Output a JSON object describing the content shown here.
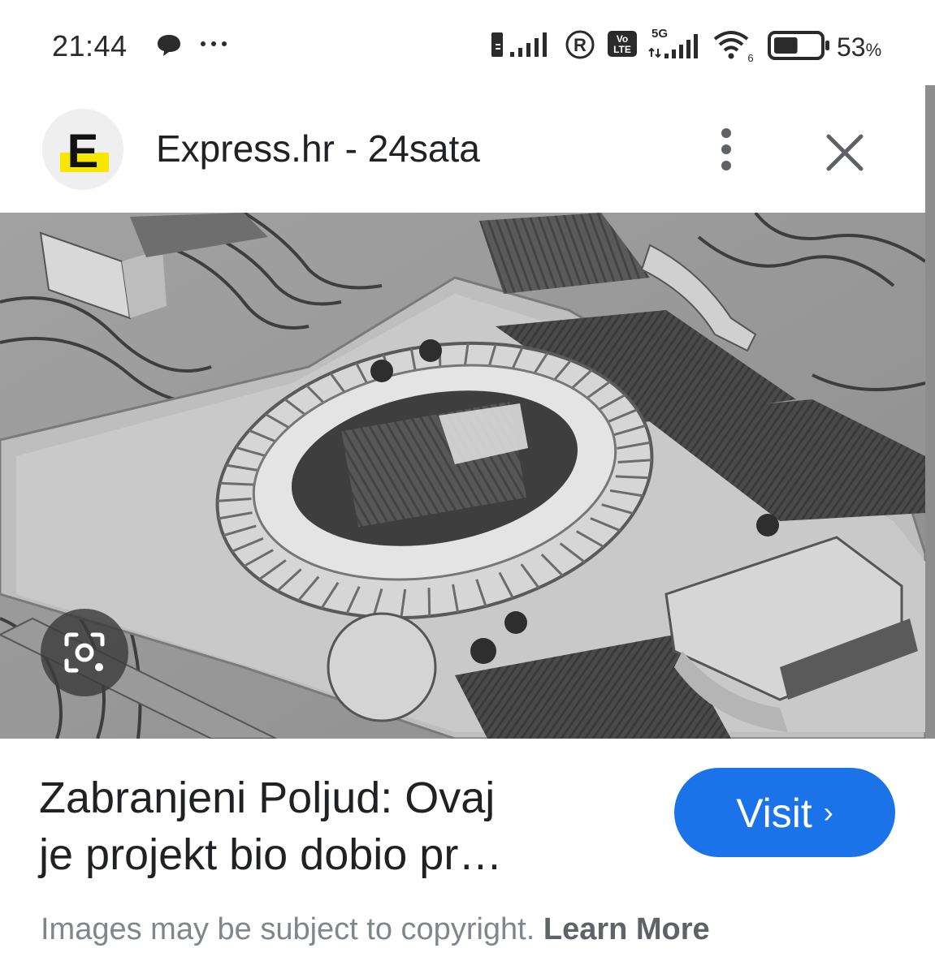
{
  "status_bar": {
    "time": "21:44",
    "left_icons": [
      "chat-bubble-icon",
      "more-dots-icon"
    ],
    "right_icons": [
      "sim-icon",
      "signal-bars-icon",
      "roaming-icon",
      "volte-icon",
      "5g-signal-icon",
      "wifi-6-icon",
      "battery-icon"
    ],
    "network_label": "5G",
    "volte_label": "Vo LTE",
    "wifi_label": "6",
    "roaming_label": "R",
    "battery_percent": "53",
    "battery_percent_symbol": "%",
    "battery_level": 0.53
  },
  "header": {
    "source_logo_letter": "E",
    "source_title": "Express.hr - 24sata",
    "more_icon": "more-vert-icon",
    "close_icon": "close-icon"
  },
  "image": {
    "lens_icon": "lens-search-icon"
  },
  "result": {
    "title_line1": "Zabranjeni Poljud: Ovaj",
    "title_line2": "je projekt bio dobio pr…",
    "visit_label": "Visit",
    "visit_chevron": "›",
    "copyright_text": "Images may be subject to copyright.",
    "learn_more": "Learn More"
  },
  "colors": {
    "accent": "#1a73e8",
    "logo_yellow": "#f7e600",
    "text_primary": "#202124",
    "text_secondary": "#80868b"
  }
}
